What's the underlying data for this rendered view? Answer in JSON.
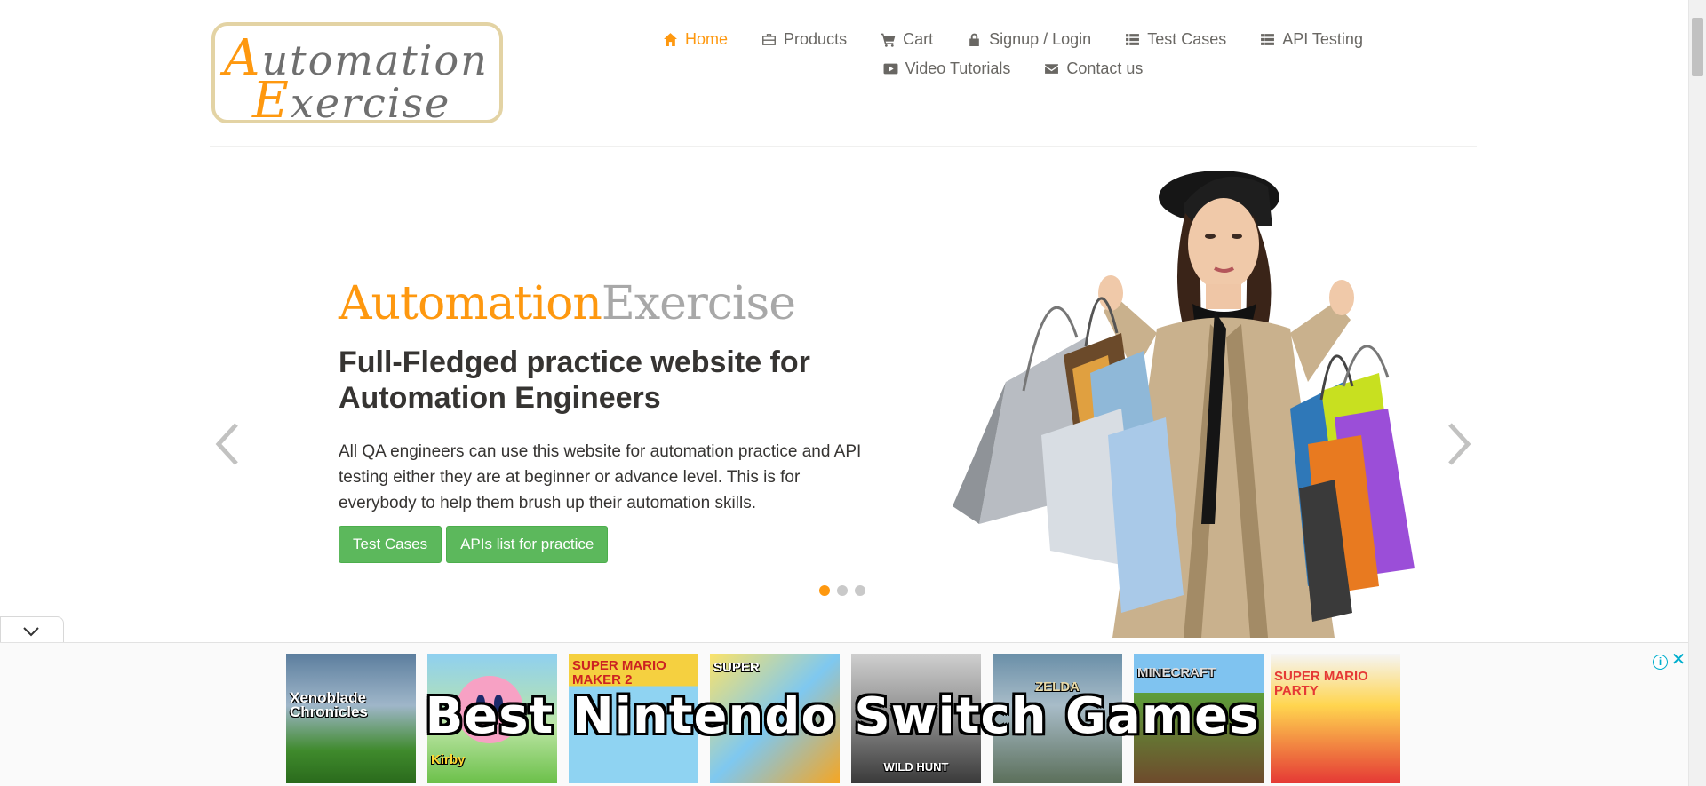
{
  "logo": {
    "line1_cap": "A",
    "line1_rest": "utomation",
    "line2_cap": "E",
    "line2_rest": "xercise"
  },
  "nav": {
    "row1": [
      {
        "label": "Home",
        "icon": "home-icon"
      },
      {
        "label": "Products",
        "icon": "products-icon"
      },
      {
        "label": "Cart",
        "icon": "cart-icon"
      },
      {
        "label": "Signup / Login",
        "icon": "lock-icon"
      },
      {
        "label": "Test Cases",
        "icon": "list-icon"
      },
      {
        "label": "API Testing",
        "icon": "list-icon"
      }
    ],
    "row2": [
      {
        "label": "Video Tutorials",
        "icon": "youtube-play-icon"
      },
      {
        "label": "Contact us",
        "icon": "envelope-icon"
      }
    ]
  },
  "hero": {
    "title_a": "Automation",
    "title_b": "Exercise",
    "subtitle": "Full-Fledged practice website for Automation Engineers",
    "description": "All QA engineers can use this website for automation practice and API testing either they are at beginner or advance level. This is for everybody to help them brush up their automation skills.",
    "btn_test_cases": "Test Cases",
    "btn_apis": "APIs list for practice",
    "slides": 3,
    "active_slide": 1
  },
  "ad": {
    "headline": "Best Nintendo Switch Games",
    "tiles": [
      {
        "label": "Xenoblade Chronicles"
      },
      {
        "label": "Kirby"
      },
      {
        "label": "SUPER MARIO MAKER 2"
      },
      {
        "label": "SUPER"
      },
      {
        "label": "WILD HUNT"
      },
      {
        "label": "ZELDA"
      },
      {
        "label": "MINECRAFT"
      },
      {
        "label": "SUPER MARIO PARTY"
      }
    ],
    "info_glyph": "i",
    "close_glyph": "✕"
  },
  "colors": {
    "accent": "#fe980f",
    "text": "#696763",
    "dark_text": "#363432",
    "button_green": "#5cb85c"
  }
}
